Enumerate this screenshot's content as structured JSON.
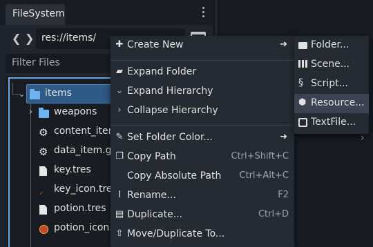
{
  "dock": {
    "tab_title": "FileSystem",
    "path": "res://items/",
    "filter_placeholder": "Filter Files",
    "back_arrow": "❮",
    "forward_arrow": "❯"
  },
  "tree": [
    {
      "label": "items",
      "kind": "folder",
      "expanded": true,
      "selected": true
    },
    {
      "label": "weapons",
      "kind": "folder"
    },
    {
      "label": "content_item",
      "kind": "gear"
    },
    {
      "label": "data_item.gd",
      "kind": "gear"
    },
    {
      "label": "key.tres",
      "kind": "file"
    },
    {
      "label": "key_icon.tres",
      "kind": "icon-key"
    },
    {
      "label": "potion.tres",
      "kind": "file"
    },
    {
      "label": "potion_icon.t",
      "kind": "icon-potion"
    }
  ],
  "context_menu": {
    "items": [
      {
        "label": "Create New",
        "icon": "plus-icon",
        "submenu": true
      },
      {
        "label": "Expand Folder",
        "icon": "folder-open-icon"
      },
      {
        "label": "Expand Hierarchy",
        "icon": "chevron-down-icon"
      },
      {
        "label": "Collapse Hierarchy",
        "icon": "chevron-right-icon"
      },
      {
        "label": "Set Folder Color...",
        "icon": "brush-icon",
        "submenu": true
      },
      {
        "label": "Copy Path",
        "icon": "copy-icon",
        "shortcut": "Ctrl+Shift+C"
      },
      {
        "label": "Copy Absolute Path",
        "icon": "",
        "shortcut": "Ctrl+Alt+C"
      },
      {
        "label": "Rename...",
        "icon": "rename-icon",
        "shortcut": "F2"
      },
      {
        "label": "Duplicate...",
        "icon": "duplicate-icon",
        "shortcut": "Ctrl+D"
      },
      {
        "label": "Move/Duplicate To...",
        "icon": "move-icon"
      }
    ]
  },
  "submenu": {
    "items": [
      {
        "label": "Folder...",
        "icon": "folder-icon"
      },
      {
        "label": "Scene...",
        "icon": "clapperboard-icon"
      },
      {
        "label": "Script...",
        "icon": "script-icon"
      },
      {
        "label": "Resource...",
        "icon": "cube-icon",
        "highlighted": true
      },
      {
        "label": "TextFile...",
        "icon": "textfile-icon"
      }
    ]
  },
  "colors": {
    "accent": "#6aa8e6",
    "selection": "#2f5a86",
    "folder": "#6eb2f0",
    "panel": "#21262e",
    "menu": "#252b33"
  }
}
